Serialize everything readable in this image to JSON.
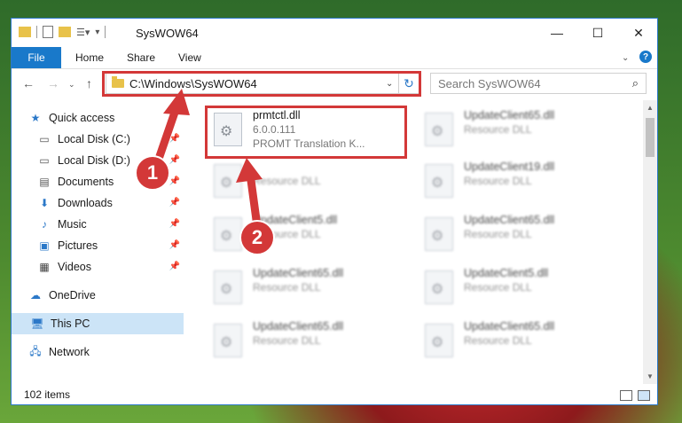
{
  "window": {
    "title": "SysWOW64"
  },
  "ribbon": {
    "file": "File",
    "home": "Home",
    "share": "Share",
    "view": "View",
    "help": "?"
  },
  "address": {
    "path": "C:\\Windows\\SysWOW64"
  },
  "search": {
    "placeholder": "Search SysWOW64"
  },
  "sidebar": {
    "items": [
      {
        "label": "Quick access"
      },
      {
        "label": "Local Disk (C:)"
      },
      {
        "label": "Local Disk (D:)"
      },
      {
        "label": "Documents"
      },
      {
        "label": "Downloads"
      },
      {
        "label": "Music"
      },
      {
        "label": "Pictures"
      },
      {
        "label": "Videos"
      },
      {
        "label": "OneDrive"
      },
      {
        "label": "This PC"
      },
      {
        "label": "Network"
      }
    ]
  },
  "files": {
    "main": {
      "name": "prmtctl.dll",
      "version": "6.0.0.111",
      "desc": "PROMT Translation K..."
    },
    "blurred_left": [
      {
        "name": "",
        "desc": "Resource DLL"
      },
      {
        "name": "UpdateClient5.dll",
        "desc": "Resource DLL"
      },
      {
        "name": "UpdateClient65.dll",
        "desc": "Resource DLL"
      },
      {
        "name": "UpdateClient65.dll",
        "desc": "Resource DLL"
      }
    ],
    "blurred_right": [
      {
        "name": "UpdateClient65.dll",
        "desc": "Resource DLL"
      },
      {
        "name": "UpdateClient19.dll",
        "desc": "Resource DLL"
      },
      {
        "name": "UpdateClient65.dll",
        "desc": "Resource DLL"
      },
      {
        "name": "UpdateClient5.dll",
        "desc": "Resource DLL"
      },
      {
        "name": "UpdateClient65.dll",
        "desc": "Resource DLL"
      }
    ]
  },
  "status": {
    "count": "102 items"
  },
  "annotations": {
    "badge1": "1",
    "badge2": "2"
  },
  "colors": {
    "accent": "#1979ca",
    "highlight": "#d33838",
    "selected": "#cce4f7"
  }
}
